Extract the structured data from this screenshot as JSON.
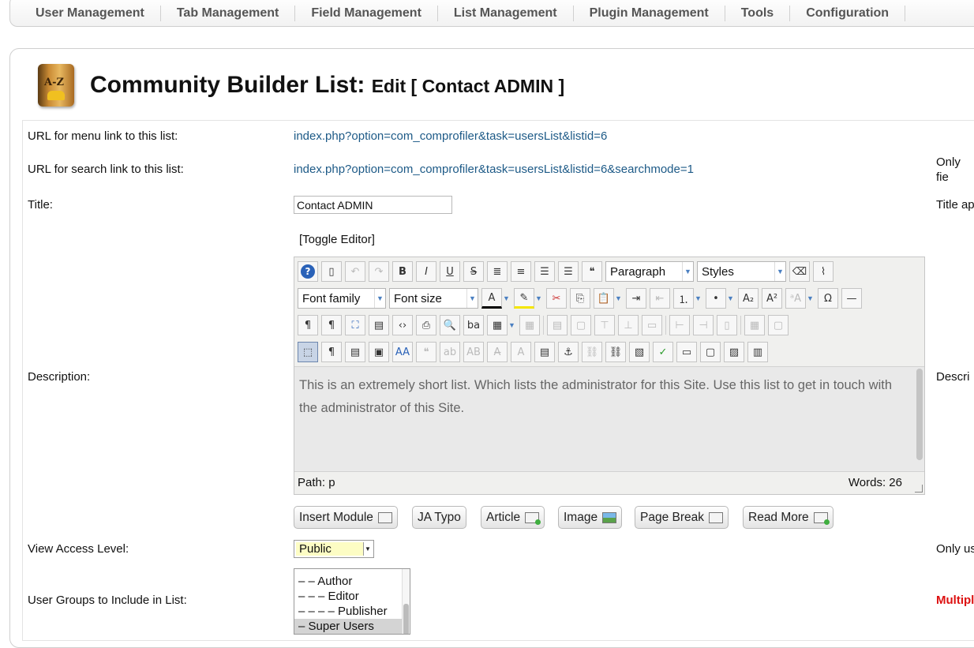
{
  "nav": {
    "items": [
      "User Management",
      "Tab Management",
      "Field Management",
      "List Management",
      "Plugin Management",
      "Tools",
      "Configuration"
    ]
  },
  "header": {
    "icon_text": "A-Z",
    "title_main": "Community Builder List:",
    "title_sub": "Edit [ Contact ADMIN ]"
  },
  "form": {
    "url_menu_label": "URL for menu link to this list:",
    "url_menu_value": "index.php?option=com_comprofiler&task=usersList&listid=6",
    "url_search_label": "URL for search link to this list:",
    "url_search_value": "index.php?option=com_comprofiler&task=usersList&listid=6&searchmode=1",
    "url_search_note": "Only fie attribut",
    "title_label": "Title:",
    "title_value": "Contact ADMIN",
    "title_note": "Title ap",
    "toggle_editor": "[Toggle Editor]",
    "description_label": "Description:",
    "description_note": "Descri",
    "view_access_label": "View Access Level:",
    "view_access_value": "Public",
    "view_access_note": "Only us",
    "user_groups_label": "User Groups to Include in List:",
    "user_groups_note": "Multipl"
  },
  "editor": {
    "format_select": "Paragraph",
    "styles_select": "Styles",
    "font_family_select": "Font family",
    "font_size_select": "Font size",
    "content": "This is an extremely short list. Which lists the administrator for this Site. Use this list to get in touch with the administrator of this Site.",
    "path": "Path:  p",
    "words": "Words: 26"
  },
  "editor_buttons": {
    "insert_module": "Insert Module",
    "ja_typo": "JA Typo",
    "article": "Article",
    "image": "Image",
    "page_break": "Page Break",
    "read_more": "Read More"
  },
  "user_groups": {
    "options": [
      "– – Author",
      "– – – Editor",
      "– – – – Publisher",
      "– Super Users"
    ],
    "selected": "– Super Users"
  }
}
